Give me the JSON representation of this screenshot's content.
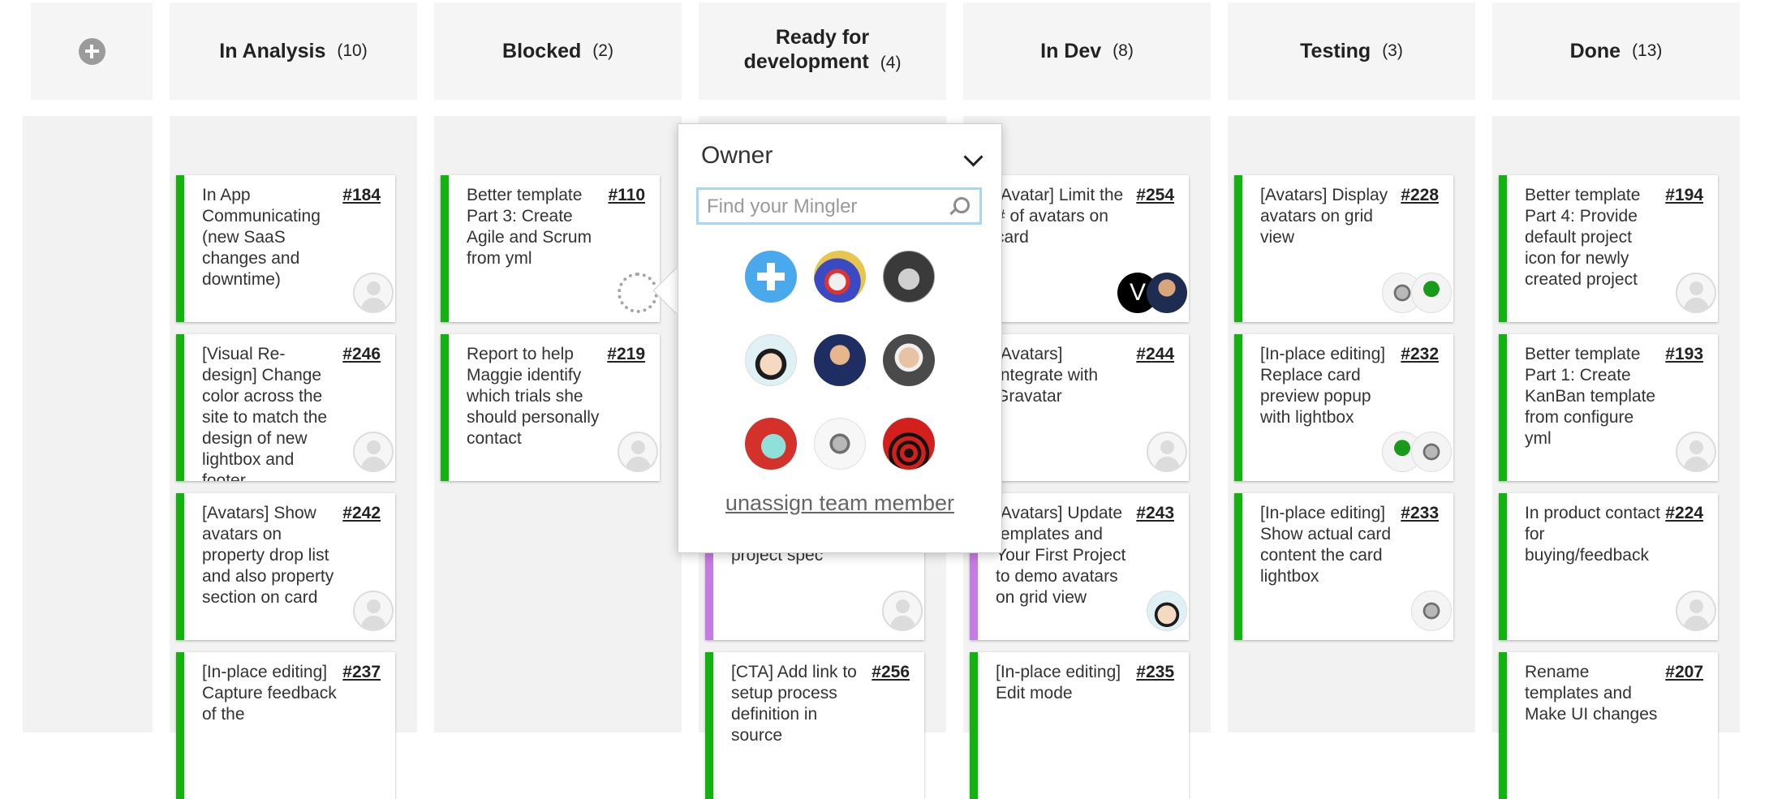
{
  "columns": [
    {
      "id": "in-analysis",
      "title": "In Analysis",
      "count": "(10)"
    },
    {
      "id": "blocked",
      "title": "Blocked",
      "count": "(2)"
    },
    {
      "id": "ready-for-development",
      "title": "Ready for development",
      "title_line1": "Ready for",
      "title_line2": "development",
      "count": "(4)"
    },
    {
      "id": "in-dev",
      "title": "In Dev",
      "count": "(8)"
    },
    {
      "id": "testing",
      "title": "Testing",
      "count": "(3)"
    },
    {
      "id": "done",
      "title": "Done",
      "count": "(13)"
    }
  ],
  "cards": {
    "c184": {
      "number": "#184",
      "title": "In App Communicating (new SaaS changes and downtime)"
    },
    "c246": {
      "number": "#246",
      "title": "[Visual Re-design] Change color across the site to match the design of new lightbox and footer"
    },
    "c242": {
      "number": "#242",
      "title": "[Avatars] Show avatars on property drop list and also property section on card"
    },
    "c237": {
      "number": "#237",
      "title": "[In-place editing] Capture feedback of the"
    },
    "c110": {
      "number": "#110",
      "title": "Better template Part 3: Create Agile and Scrum from yml"
    },
    "c219": {
      "number": "#219",
      "title": "Report to help Maggie identify which trials she should personally contact"
    },
    "rfd_hidden": {
      "title": "project spec"
    },
    "c256": {
      "number": "#256",
      "title": "[CTA] Add link to setup process definition in source"
    },
    "c254": {
      "number": "#254",
      "title": "[Avatar] Limit the # of avatars on card"
    },
    "c244": {
      "number": "#244",
      "title": "[Avatars] Integrate with Gravatar"
    },
    "c243": {
      "number": "#243",
      "title": "[Avatars] Update templates and Your First Project to demo avatars on grid view"
    },
    "c235": {
      "number": "#235",
      "title": "[In-place editing] Edit mode"
    },
    "c228": {
      "number": "#228",
      "title": "[Avatars] Display avatars on grid view"
    },
    "c232": {
      "number": "#232",
      "title": "[In-place editing] Replace card preview popup with lightbox"
    },
    "c233": {
      "number": "#233",
      "title": "[In-place editing] Show actual card content the card lightbox"
    },
    "c194": {
      "number": "#194",
      "title": "Better template Part 4: Provide default project icon for newly created project"
    },
    "c193": {
      "number": "#193",
      "title": "Better template Part 1: Create KanBan template from configure yml"
    },
    "c224": {
      "number": "#224",
      "title": "In product contact for buying/feedback"
    },
    "c207": {
      "number": "#207",
      "title": "Rename templates and Make UI changes"
    }
  },
  "avatar_v_letter": "V",
  "popup": {
    "title": "Owner",
    "search_placeholder": "Find your Mingler",
    "unassign_label": "unassign team member"
  },
  "colors": {
    "card_stripe_green": "#11b40f",
    "card_stripe_purple": "#c67ae3",
    "popup_search_border": "#a5d8f4",
    "add_member_blue": "#4aa9ec"
  }
}
